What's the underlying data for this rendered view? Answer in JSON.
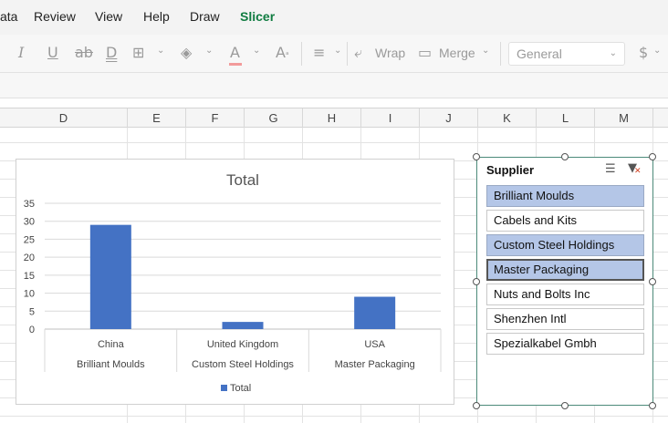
{
  "menu": {
    "items": [
      {
        "label": "ata",
        "active": false
      },
      {
        "label": "Review",
        "active": false
      },
      {
        "label": "View",
        "active": false
      },
      {
        "label": "Help",
        "active": false
      },
      {
        "label": "Draw",
        "active": false
      },
      {
        "label": "Slicer",
        "active": true
      }
    ]
  },
  "ribbon": {
    "wrap_label": "Wrap",
    "merge_label": "Merge",
    "number_format": "General"
  },
  "columns": [
    "D",
    "E",
    "F",
    "G",
    "H",
    "I",
    "J",
    "K",
    "L",
    "M"
  ],
  "chart_data": {
    "type": "bar",
    "title": "Total",
    "categories": [
      {
        "outer": "China",
        "inner": "Brilliant Moulds"
      },
      {
        "outer": "United Kingdom",
        "inner": "Custom Steel Holdings"
      },
      {
        "outer": "USA",
        "inner": "Master Packaging"
      }
    ],
    "series": [
      {
        "name": "Total",
        "values": [
          29,
          2,
          9
        ],
        "color": "#4472c4"
      }
    ],
    "ylim": [
      0,
      35
    ],
    "yticks": [
      0,
      5,
      10,
      15,
      20,
      25,
      30,
      35
    ],
    "grid": true,
    "legend": "bottom"
  },
  "slicer": {
    "title": "Supplier",
    "items": [
      {
        "label": "Brilliant Moulds",
        "selected": true
      },
      {
        "label": "Cabels and Kits",
        "selected": false
      },
      {
        "label": "Custom Steel Holdings",
        "selected": true
      },
      {
        "label": "Master Packaging",
        "selected": true,
        "focused": true
      },
      {
        "label": "Nuts and Bolts Inc",
        "selected": false
      },
      {
        "label": "Shenzhen Intl",
        "selected": false
      },
      {
        "label": "Spezialkabel Gmbh",
        "selected": false
      }
    ]
  }
}
